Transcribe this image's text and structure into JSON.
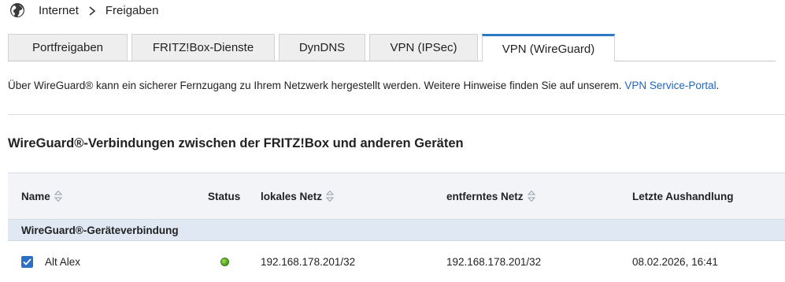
{
  "breadcrumb": {
    "section": "Internet",
    "page": "Freigaben"
  },
  "tabs": [
    {
      "label": "Portfreigaben"
    },
    {
      "label": "FRITZ!Box-Dienste"
    },
    {
      "label": "DynDNS"
    },
    {
      "label": "VPN (IPSec)"
    },
    {
      "label": "VPN (WireGuard)",
      "active": true
    }
  ],
  "intro": {
    "text": "Über WireGuard® kann ein sicherer Fernzugang zu Ihrem Netzwerk hergestellt werden. Weitere Hinweise finden Sie auf unserem. ",
    "link": "VPN Service-Portal",
    "end": "."
  },
  "section_title": "WireGuard®-Verbindungen zwischen der FRITZ!Box und anderen Geräten",
  "table": {
    "headers": {
      "name": "Name",
      "status": "Status",
      "local": "lokales Netz",
      "remote": "entferntes Netz",
      "last": "Letzte Aushandlung"
    },
    "group": "WireGuard®-Geräteverbindung",
    "rows": [
      {
        "checked": true,
        "name": "Alt Alex",
        "status": "online",
        "local": "192.168.178.201/32",
        "remote": "192.168.178.201/32",
        "last": "08.02.2026, 16:41"
      }
    ]
  },
  "colors": {
    "accent": "#2e79c7",
    "link": "#2266bb",
    "status_ok": "#5cb82a",
    "header_bg": "#f2f4f7",
    "group_bg": "#dfe8f3"
  }
}
